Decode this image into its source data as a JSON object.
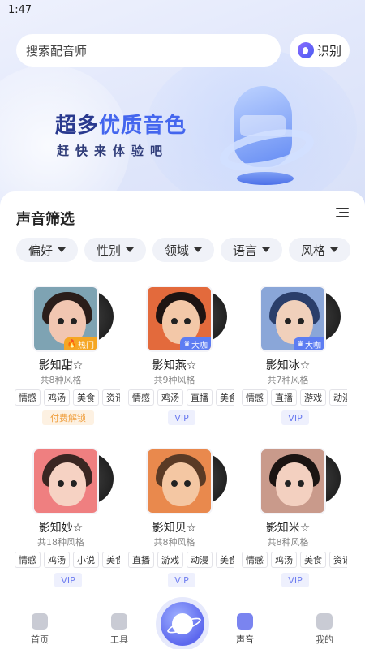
{
  "status_bar": {
    "time": "1:47"
  },
  "search": {
    "placeholder": "搜索配音师",
    "identify_label": "识别"
  },
  "hero": {
    "title_part1": "超多",
    "title_part2": "优质音色",
    "subtitle": "赶快来体验吧"
  },
  "filter_section": {
    "title": "声音筛选",
    "chips": [
      "偏好",
      "性别",
      "领域",
      "语言",
      "风格"
    ]
  },
  "voices": [
    {
      "name": "影知甜☆",
      "styles": "共8种风格",
      "badge": "热门",
      "badge_type": "hot",
      "tags": [
        "情感",
        "鸡汤",
        "美食",
        "资讯"
      ],
      "action": "付费解锁",
      "action_type": "unlock",
      "palette": {
        "bg": "#7ea3b3",
        "hair": "#2a1d1a",
        "face": "#f1c6b1"
      }
    },
    {
      "name": "影知燕☆",
      "styles": "共9种风格",
      "badge": "大咖",
      "badge_type": "vip",
      "tags": [
        "情感",
        "鸡汤",
        "直播",
        "美食"
      ],
      "action": "VIP",
      "action_type": "vip",
      "palette": {
        "bg": "#e36a3c",
        "hair": "#1e1412",
        "face": "#f3c8a8"
      }
    },
    {
      "name": "影知冰☆",
      "styles": "共7种风格",
      "badge": "大咖",
      "badge_type": "vip",
      "tags": [
        "情感",
        "直播",
        "游戏",
        "动漫"
      ],
      "action": "VIP",
      "action_type": "vip",
      "palette": {
        "bg": "#8aa6d8",
        "hair": "#2a3e6a",
        "face": "#f0d0bb"
      }
    },
    {
      "name": "影知妙☆",
      "styles": "共18种风格",
      "badge": "",
      "badge_type": "",
      "tags": [
        "情感",
        "鸡汤",
        "小说",
        "美食"
      ],
      "action": "VIP",
      "action_type": "vip",
      "palette": {
        "bg": "#ef7f80",
        "hair": "#3a2622",
        "face": "#f6d2c3"
      }
    },
    {
      "name": "影知贝☆",
      "styles": "共8种风格",
      "badge": "",
      "badge_type": "",
      "tags": [
        "直播",
        "游戏",
        "动漫",
        "美食"
      ],
      "action": "VIP",
      "action_type": "vip",
      "palette": {
        "bg": "#e9894d",
        "hair": "#5a3a25",
        "face": "#f4c7a3"
      }
    },
    {
      "name": "影知米☆",
      "styles": "共8种风格",
      "badge": "",
      "badge_type": "",
      "tags": [
        "情感",
        "鸡汤",
        "美食",
        "资讯"
      ],
      "action": "VIP",
      "action_type": "vip",
      "palette": {
        "bg": "#c99a8b",
        "hair": "#1b1412",
        "face": "#f3d0c0"
      }
    }
  ],
  "tabbar": {
    "items": [
      {
        "label": "首页",
        "icon": "home-icon"
      },
      {
        "label": "工具",
        "icon": "tools-icon"
      },
      {
        "label": "",
        "icon": "planet-icon"
      },
      {
        "label": "声音",
        "icon": "voice-icon",
        "active": true
      },
      {
        "label": "我的",
        "icon": "profile-icon"
      }
    ]
  }
}
